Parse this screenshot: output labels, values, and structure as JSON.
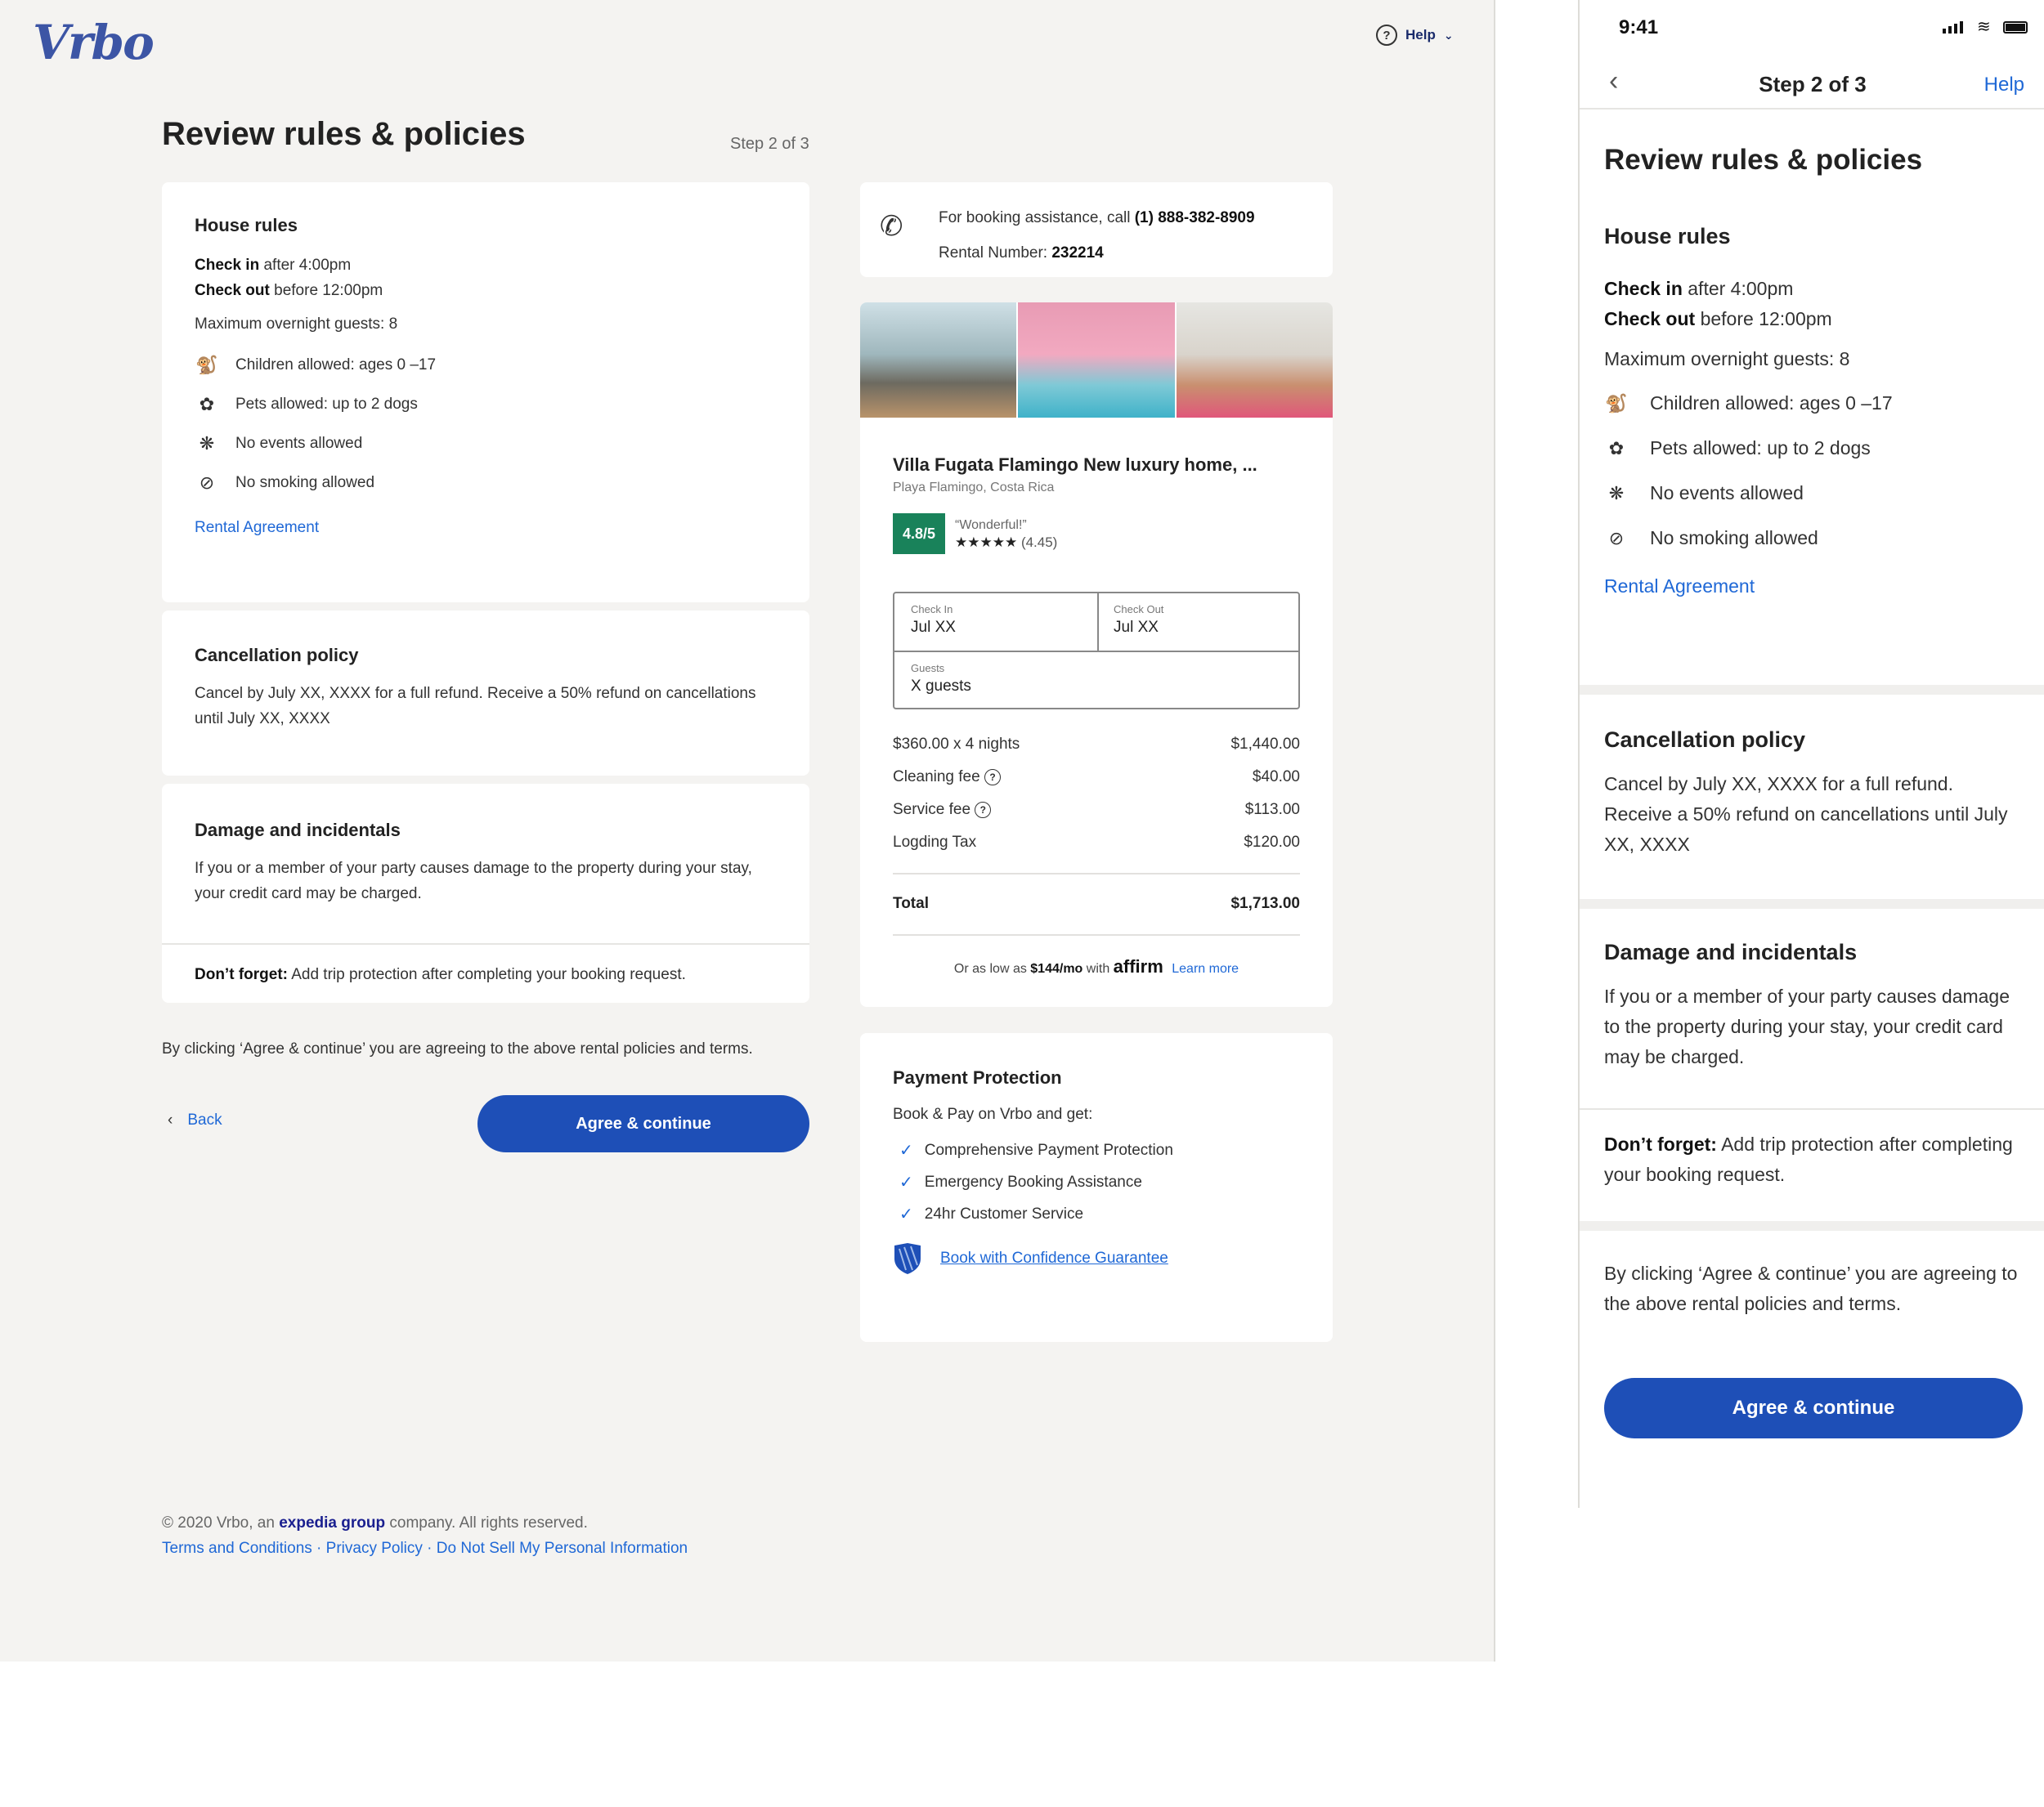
{
  "desktop": {
    "logo": "Vrbo",
    "help": {
      "label": "Help"
    },
    "title": "Review rules & policies",
    "step": "Step 2 of 3",
    "house_rules": {
      "heading": "House rules",
      "checkin_bold": "Check in",
      "checkin_rest": " after 4:00pm",
      "checkout_bold": "Check out",
      "checkout_rest": " before 12:00pm",
      "max_guests": "Maximum overnight guests: 8",
      "rules": [
        "Children allowed: ages 0 –17",
        "Pets allowed: up to 2 dogs",
        "No events allowed",
        "No smoking allowed"
      ],
      "agreement_link": "Rental Agreement"
    },
    "cancellation": {
      "heading": "Cancellation policy",
      "text": "Cancel by July XX, XXXX for a full refund. Receive a 50% refund on cancellations until July XX, XXXX"
    },
    "damage": {
      "heading": "Damage and incidentals",
      "text": "If you or a member of your party causes damage to the property during your stay, your credit card may be charged.",
      "reminder_bold": "Don’t forget:",
      "reminder_rest": " Add trip protection after completing your booking request."
    },
    "agree_text": "By clicking ‘Agree & continue’ you are agreeing to the above rental policies and terms.",
    "back_label": "Back",
    "agree_button": "Agree & continue",
    "assistance": {
      "prefix": "For booking assistance, call ",
      "phone": "(1) 888-382-8909",
      "rental_label": "Rental Number: ",
      "rental_number": "232214"
    },
    "property": {
      "name": "Villa Fugata Flamingo New luxury home, ...",
      "location": "Playa Flamingo, Costa Rica",
      "rating": "4.8/5",
      "rating_word": "“Wonderful!”",
      "stars": "★★★★★",
      "review_score": "(4.45)",
      "checkin_label": "Check In",
      "checkin_value": "Jul XX",
      "checkout_label": "Check Out",
      "checkout_value": "Jul XX",
      "guests_label": "Guests",
      "guests_value": "X guests",
      "price_rows": [
        {
          "label": "$360.00 x 4 nights",
          "value": "$1,440.00"
        },
        {
          "label": "Cleaning fee",
          "value": "$40.00"
        },
        {
          "label": "Service fee",
          "value": "$113.00"
        },
        {
          "label": "Logding Tax",
          "value": "$120.00"
        }
      ],
      "total_label": "Total",
      "total_value": "$1,713.00",
      "affirm_prefix": "Or as low as ",
      "affirm_amount": "$144/mo",
      "affirm_with": " with ",
      "affirm_brand": "affirm",
      "affirm_link": "Learn more"
    },
    "payment_protection": {
      "heading": "Payment Protection",
      "subtitle": "Book & Pay on Vrbo and get:",
      "items": [
        "Comprehensive Payment Protection",
        "Emergency Booking Assistance",
        "24hr Customer Service"
      ],
      "guarantee_link": "Book with Confidence Guarantee"
    },
    "footer": {
      "copyright_prefix": "© 2020 Vrbo, an ",
      "brand": "expedia group",
      "copyright_suffix": " company. All rights reserved.",
      "links": [
        "Terms and Conditions",
        "Privacy Policy",
        "Do Not Sell My Personal Information"
      ]
    }
  },
  "mobile": {
    "time": "9:41",
    "nav_title": "Step 2 of 3",
    "nav_help": "Help",
    "title": "Review rules & policies",
    "agree_button": "Agree & continue"
  },
  "colors": {
    "accent": "#1e4fb7",
    "link": "#1f68d6",
    "rating": "#19825a"
  }
}
